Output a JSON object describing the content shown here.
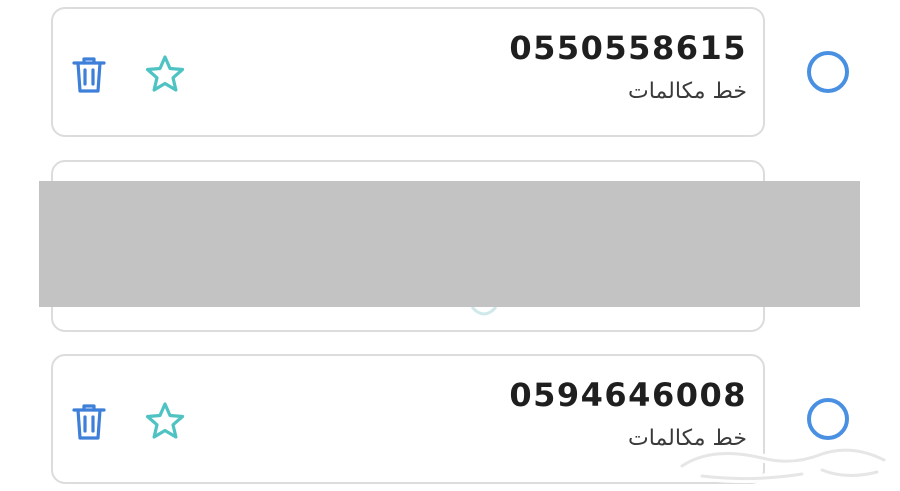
{
  "entries": [
    {
      "number": "0550558615",
      "type_label": "خط مكالمات",
      "selected": false
    },
    {
      "number": "0594646008",
      "type_label": "خط مكالمات",
      "selected": false
    }
  ],
  "watermark": {
    "text": "حراج"
  },
  "colors": {
    "trash": "#3d7fd9",
    "star": "#4fc3c3",
    "radio": "#4a90e2",
    "redaction": "#c3c3c3",
    "card_border": "#dcdcdc"
  },
  "icons": {
    "delete": "trash-icon",
    "favorite": "star-outline-icon",
    "select": "radio-circle"
  }
}
